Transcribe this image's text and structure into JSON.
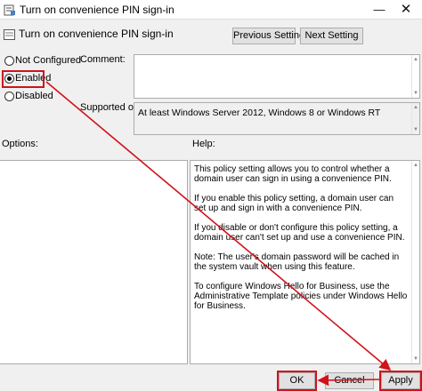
{
  "window": {
    "title": "Turn on convenience PIN sign-in",
    "minimize_icon": "minimize-icon",
    "close_icon": "close-icon",
    "minimize_glyph": "—",
    "close_glyph": "✕"
  },
  "header": {
    "title": "Turn on convenience PIN sign-in",
    "icon": "policy-setting-icon"
  },
  "nav": {
    "previous_label": "Previous Setting",
    "next_label": "Next Setting"
  },
  "state": {
    "options": [
      {
        "label": "Not Configured",
        "checked": false
      },
      {
        "label": "Enabled",
        "checked": true
      },
      {
        "label": "Disabled",
        "checked": false
      }
    ]
  },
  "comment": {
    "label": "Comment:",
    "value": ""
  },
  "supported": {
    "label": "Supported on:",
    "value": "At least Windows Server 2012, Windows 8 or Windows RT"
  },
  "options_panel": {
    "label": "Options:"
  },
  "help": {
    "label": "Help:",
    "paragraphs": [
      "This policy setting allows you to control whether a domain user can sign in using a convenience PIN.",
      "If you enable this policy setting, a domain user can set up and sign in with a convenience PIN.",
      "If you disable or don't configure this policy setting, a domain user can't set up and use a convenience PIN.",
      "Note: The user's domain password will be cached in the system vault when using this feature.",
      "To configure Windows Hello for Business, use the Administrative Template policies under Windows Hello for Business."
    ]
  },
  "footer": {
    "ok_label": "OK",
    "cancel_label": "Cancel",
    "apply_label": "Apply"
  },
  "annotation": {
    "color": "#d0121b"
  }
}
